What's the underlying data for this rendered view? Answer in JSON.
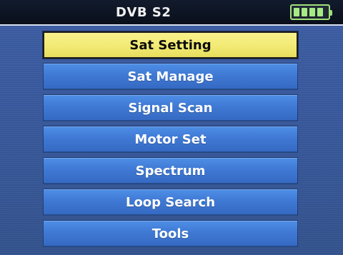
{
  "header": {
    "title": "DVB S2",
    "battery_level": 1.0,
    "battery_icon": "battery-icon"
  },
  "menu": {
    "selected_index": 0,
    "items": [
      {
        "label": "Sat Setting"
      },
      {
        "label": "Sat Manage"
      },
      {
        "label": "Signal Scan"
      },
      {
        "label": "Motor Set"
      },
      {
        "label": "Spectrum"
      },
      {
        "label": "Loop Search"
      },
      {
        "label": "Tools"
      }
    ]
  },
  "colors": {
    "selected_bg": "#f2ea74",
    "item_bg": "#3f79d4",
    "background": "#3a5a9f",
    "battery": "#9fe07a"
  }
}
